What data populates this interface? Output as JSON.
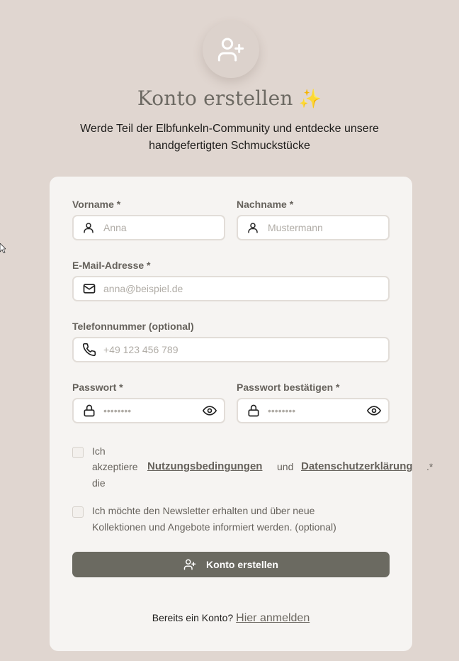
{
  "header": {
    "title": "Konto erstellen",
    "sparkle": "✨",
    "subtitle": "Werde Teil der Elbfunkeln-Community und entdecke unsere handgefertigten Schmuckstücke"
  },
  "form": {
    "first_name": {
      "label": "Vorname *",
      "placeholder": "Anna",
      "value": ""
    },
    "last_name": {
      "label": "Nachname *",
      "placeholder": "Mustermann",
      "value": ""
    },
    "email": {
      "label": "E-Mail-Adresse *",
      "placeholder": "anna@beispiel.de",
      "value": ""
    },
    "phone": {
      "label": "Telefonnummer (optional)",
      "placeholder": "+49 123 456 789",
      "value": ""
    },
    "password": {
      "label": "Passwort *",
      "placeholder": "••••••••",
      "value": ""
    },
    "password_confirm": {
      "label": "Passwort bestätigen *",
      "placeholder": "••••••••",
      "value": ""
    },
    "terms": {
      "word1": "Ich",
      "word2": "akzeptiere",
      "word3": "die",
      "terms_link": "Nutzungsbedingungen",
      "and": "und",
      "privacy_link": "Datenschutzerklärung",
      "suffix": ".*",
      "checked": false
    },
    "newsletter": {
      "line1": "Ich möchte den Newsletter erhalten und über neue",
      "line2": "Kollektionen und Angebote informiert werden. (optional)",
      "checked": false
    },
    "submit_label": "Konto erstellen"
  },
  "footer": {
    "prompt": "Bereits ein Konto?",
    "login_link": "Hier anmelden"
  },
  "colors": {
    "background": "#e0d6d0",
    "card": "#f6f4f2",
    "button": "#6b6a61",
    "label": "#66625c"
  },
  "icons": {
    "avatar": "user-plus-icon",
    "name_fields": "user-icon",
    "email": "mail-icon",
    "phone": "phone-icon",
    "password": "lock-icon",
    "password_toggle": "eye-icon",
    "submit": "user-plus-icon"
  }
}
